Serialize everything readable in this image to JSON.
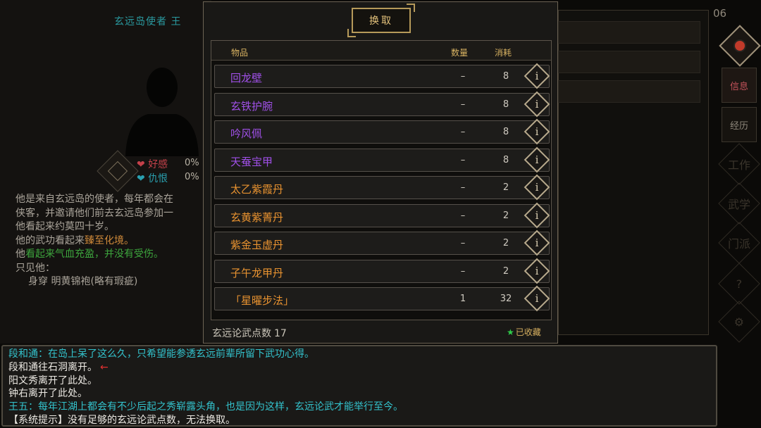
{
  "npc": {
    "title": "玄远岛使者  王",
    "favor_label": "好感",
    "favor_value": "0%",
    "hate_label": "仇恨",
    "hate_value": "0%",
    "desc_lines": [
      "他是来自玄远岛的使者，每年都会在",
      "侠客，并邀请他们前去玄远岛参加一",
      "他看起来约莫四十岁。"
    ],
    "martial_prefix": "他的武功看起来",
    "martial_value": "臻至化境。",
    "health_prefix": "他",
    "health_value": "看起来气血充盈，并没有受伤。",
    "see_label": "只见他：",
    "wearing": "身穿  明黄锦袍(略有瑕疵)"
  },
  "right_panel": {
    "number": "06"
  },
  "nav": {
    "info": "信息",
    "experience": "经历",
    "work": "工作",
    "martial": "武学",
    "sect": "门派",
    "help": "?",
    "settings": "⚙"
  },
  "exchange": {
    "title": "换取",
    "headers": {
      "item": "物品",
      "qty": "数量",
      "cost": "消耗"
    },
    "items": [
      {
        "name": "回龙壁",
        "qty": "–",
        "cost": "8",
        "color": "#a050e8"
      },
      {
        "name": "玄铁护腕",
        "qty": "–",
        "cost": "8",
        "color": "#a050e8"
      },
      {
        "name": "吟风佩",
        "qty": "–",
        "cost": "8",
        "color": "#a050e8"
      },
      {
        "name": "天蚕宝甲",
        "qty": "–",
        "cost": "8",
        "color": "#a050e8"
      },
      {
        "name": "太乙紫霞丹",
        "qty": "–",
        "cost": "2",
        "color": "#e89230"
      },
      {
        "name": "玄黄紫菁丹",
        "qty": "–",
        "cost": "2",
        "color": "#e89230"
      },
      {
        "name": "紫金玉虚丹",
        "qty": "–",
        "cost": "2",
        "color": "#e89230"
      },
      {
        "name": "子午龙甲丹",
        "qty": "–",
        "cost": "2",
        "color": "#e89230"
      },
      {
        "name": "「星曜步法」",
        "qty": "1",
        "cost": "32",
        "color": "#e89230"
      }
    ],
    "info_glyph": "i",
    "points_label": "玄远论武点数",
    "points_value": "17",
    "collected_label": "已收藏",
    "collected_icon": "★"
  },
  "chat": {
    "lines": [
      "段和通：在岛上呆了这么久，只希望能参透玄远前辈所留下武功心得。",
      "段和通往石洞离开。",
      "阳文秀离开了此处。",
      "钟右离开了此处。",
      "王五：每年江湖上都会有不少后起之秀崭露头角，也是因为这样，玄远论武才能举行至今。",
      "【系统提示】没有足够的玄远论武点数，无法换取。"
    ],
    "arrow": "←"
  },
  "colors": {
    "purple": "#a050e8",
    "orange": "#e89230",
    "cyan": "#33c2cc",
    "gold": "#d8b262"
  }
}
